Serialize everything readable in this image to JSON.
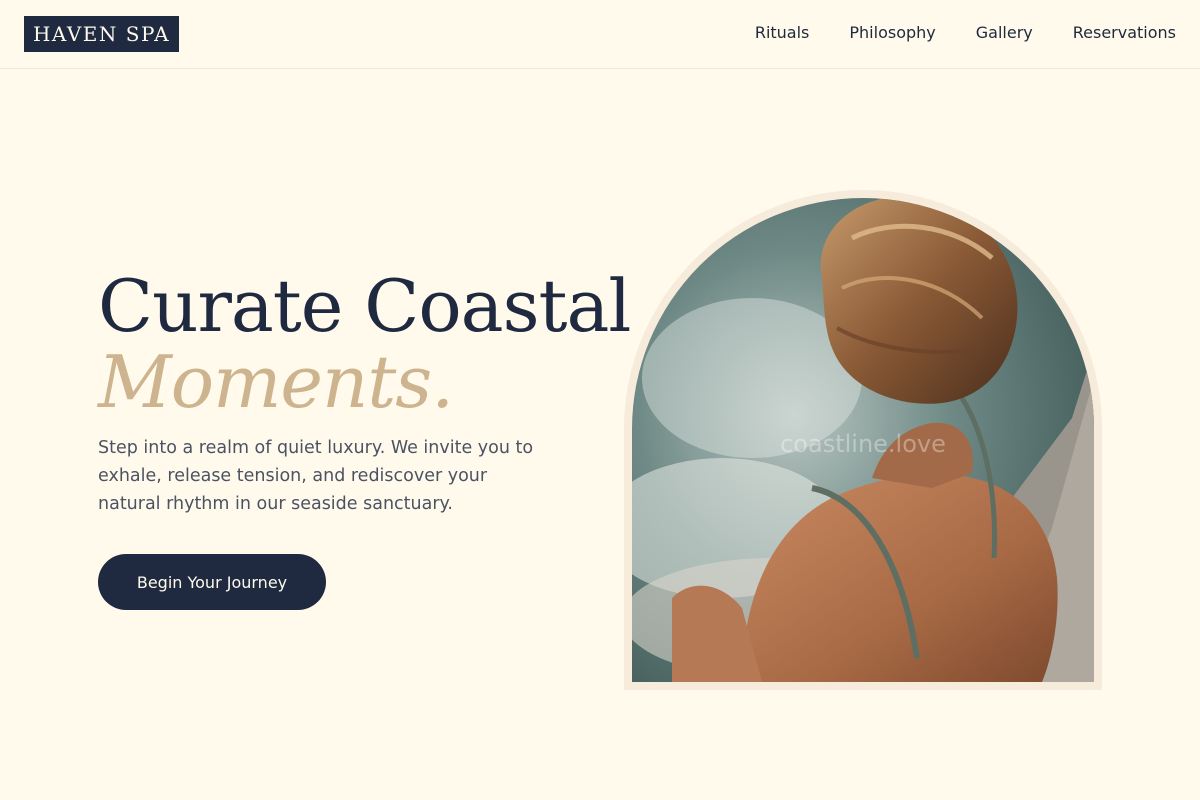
{
  "nav": {
    "logo": "HAVEN SPA",
    "links": [
      "Rituals",
      "Philosophy",
      "Gallery",
      "Reservations"
    ]
  },
  "hero": {
    "headline_line1": "Curate Coastal",
    "headline_line2": "Moments.",
    "intro": "Step into a realm of quiet luxury. We invite you to exhale, release tension, and rediscover your natural rhythm in our seaside sanctuary.",
    "cta_label": "Begin Your Journey",
    "image_watermark": "coastline.love",
    "image_subject": "woman-in-spa-pool-photo"
  },
  "colors": {
    "background": "#fffaec",
    "navy": "#1f2a40",
    "accent_gold": "#cdb48e",
    "arch_frame": "#f7ebdc"
  }
}
